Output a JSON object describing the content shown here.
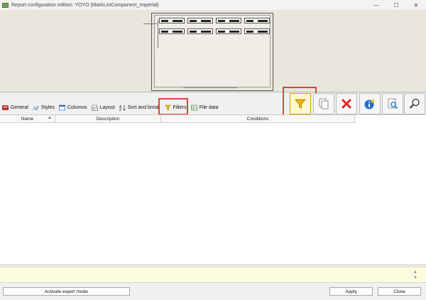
{
  "window": {
    "title": "Report configuration edition: YOYO (MarkListComponent_Imperial)",
    "minimize": "—",
    "maximize": "☐",
    "close": "✕"
  },
  "tabs": [
    {
      "label": "General",
      "icon": "general-icon"
    },
    {
      "label": "Styles",
      "icon": "styles-icon"
    },
    {
      "label": "Columns",
      "icon": "columns-icon"
    },
    {
      "label": "Layout",
      "icon": "layout-icon"
    },
    {
      "label": "Sort and break",
      "icon": "sort-icon"
    },
    {
      "label": "Filters",
      "icon": "filter-icon",
      "selected": true
    },
    {
      "label": "File data",
      "icon": "file-data-icon"
    }
  ],
  "toolbar": {
    "buttons": [
      "filter-icon",
      "copy-icon",
      "delete-icon",
      "info-icon",
      "preview-icon",
      "search-icon"
    ]
  },
  "table": {
    "columns": [
      "Name",
      "Description",
      "Conditions"
    ],
    "rows": []
  },
  "footer": {
    "expert_mode_label": "Activate expert mode",
    "apply_label": "Apply",
    "close_label": "Close"
  },
  "colors": {
    "highlight": "#e0403f",
    "preview_bg": "#e9e6dc",
    "info_bg": "#fbfbe0"
  }
}
